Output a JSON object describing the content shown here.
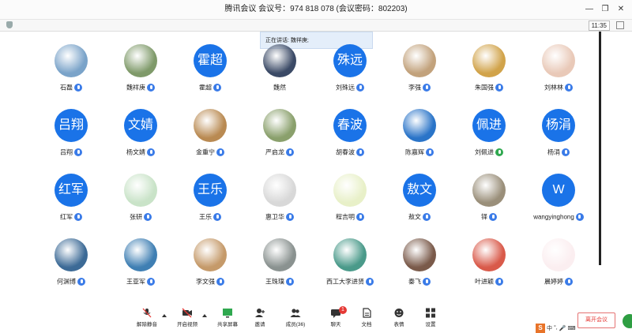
{
  "window": {
    "title": "腾讯会议  会议号：974 818 078  (会议密码：802203)",
    "clock": "11:35"
  },
  "speaking": {
    "label": "正在讲话: 魏祥庚;"
  },
  "participants": [
    {
      "name": "石磊",
      "avatar": "photo",
      "color": "#7aa3c9",
      "mic": "blue"
    },
    {
      "name": "魏祥庚",
      "avatar": "photo",
      "color": "#7f9a6a",
      "mic": "blue"
    },
    {
      "name": "霍超",
      "avatar": "text",
      "initials": "霍超",
      "mic": "blue"
    },
    {
      "name": "魏然",
      "avatar": "photo",
      "color": "#3b4a66",
      "mic": "none"
    },
    {
      "name": "刘殊远",
      "avatar": "text",
      "initials": "殊远",
      "mic": "blue"
    },
    {
      "name": "李强",
      "avatar": "photo",
      "color": "#c2a27c",
      "mic": "blue"
    },
    {
      "name": "朱国强",
      "avatar": "photo",
      "color": "#d1a34a",
      "mic": "blue"
    },
    {
      "name": "刘林林",
      "avatar": "photo",
      "color": "#e9c9b8",
      "mic": "blue"
    },
    {
      "name": "吕翔",
      "avatar": "text",
      "initials": "吕翔",
      "mic": "blue"
    },
    {
      "name": "杨文婧",
      "avatar": "text",
      "initials": "文婧",
      "mic": "blue"
    },
    {
      "name": "金重宁",
      "avatar": "photo",
      "color": "#b98a52",
      "mic": "blue"
    },
    {
      "name": "严启龙",
      "avatar": "photo",
      "color": "#8aa06c",
      "mic": "blue"
    },
    {
      "name": "胡春波",
      "avatar": "text",
      "initials": "春波",
      "mic": "blue"
    },
    {
      "name": "陈嘉辉",
      "avatar": "photo",
      "color": "#2a74c8",
      "mic": "blue"
    },
    {
      "name": "刘佩进",
      "avatar": "text",
      "initials": "佩进",
      "mic": "green"
    },
    {
      "name": "杨涓",
      "avatar": "text",
      "initials": "杨涓",
      "mic": "blue"
    },
    {
      "name": "红军",
      "avatar": "text",
      "initials": "红军",
      "mic": "blue"
    },
    {
      "name": "张研",
      "avatar": "photo",
      "color": "#c9e3c8",
      "mic": "blue"
    },
    {
      "name": "王乐",
      "avatar": "text",
      "initials": "王乐",
      "mic": "blue"
    },
    {
      "name": "惠卫华",
      "avatar": "photo",
      "color": "#d8d8d8",
      "mic": "blue"
    },
    {
      "name": "程吉明",
      "avatar": "photo",
      "color": "#e8f0c8",
      "mic": "blue"
    },
    {
      "name": "敖文",
      "avatar": "text",
      "initials": "敖文",
      "mic": "blue"
    },
    {
      "name": "铎",
      "avatar": "photo",
      "color": "#9a8f7a",
      "mic": "blue"
    },
    {
      "name": "wangyinghong",
      "avatar": "text",
      "initials": "W",
      "mic": "blue"
    },
    {
      "name": "何渊博",
      "avatar": "photo",
      "color": "#3c6a96",
      "mic": "blue"
    },
    {
      "name": "王亚军",
      "avatar": "photo",
      "color": "#3f7fb3",
      "mic": "blue"
    },
    {
      "name": "李文强",
      "avatar": "photo",
      "color": "#c59a6a",
      "mic": "blue"
    },
    {
      "name": "王珠璞",
      "avatar": "photo",
      "color": "#8a9290",
      "mic": "blue"
    },
    {
      "name": "西工大李进贤",
      "avatar": "photo",
      "color": "#4a9a8a",
      "mic": "blue"
    },
    {
      "name": "秦飞",
      "avatar": "photo",
      "color": "#7a5a4a",
      "mic": "blue"
    },
    {
      "name": "叶进颖",
      "avatar": "photo",
      "color": "#d95a4a",
      "mic": "blue"
    },
    {
      "name": "晨婷婷",
      "avatar": "photo",
      "color": "#fbeef0",
      "mic": "blue"
    }
  ],
  "bottombar": {
    "mute": "解除静音",
    "video": "开启视频",
    "share": "共享屏幕",
    "invite": "邀请",
    "members": "成员(36)",
    "chat": "聊天",
    "chat_badge": "1",
    "docs": "文档",
    "emoji": "表情",
    "settings": "设置",
    "leave": "离开会议"
  },
  "ime": {
    "logo": "S",
    "lang": "中",
    "punct": "°,"
  }
}
